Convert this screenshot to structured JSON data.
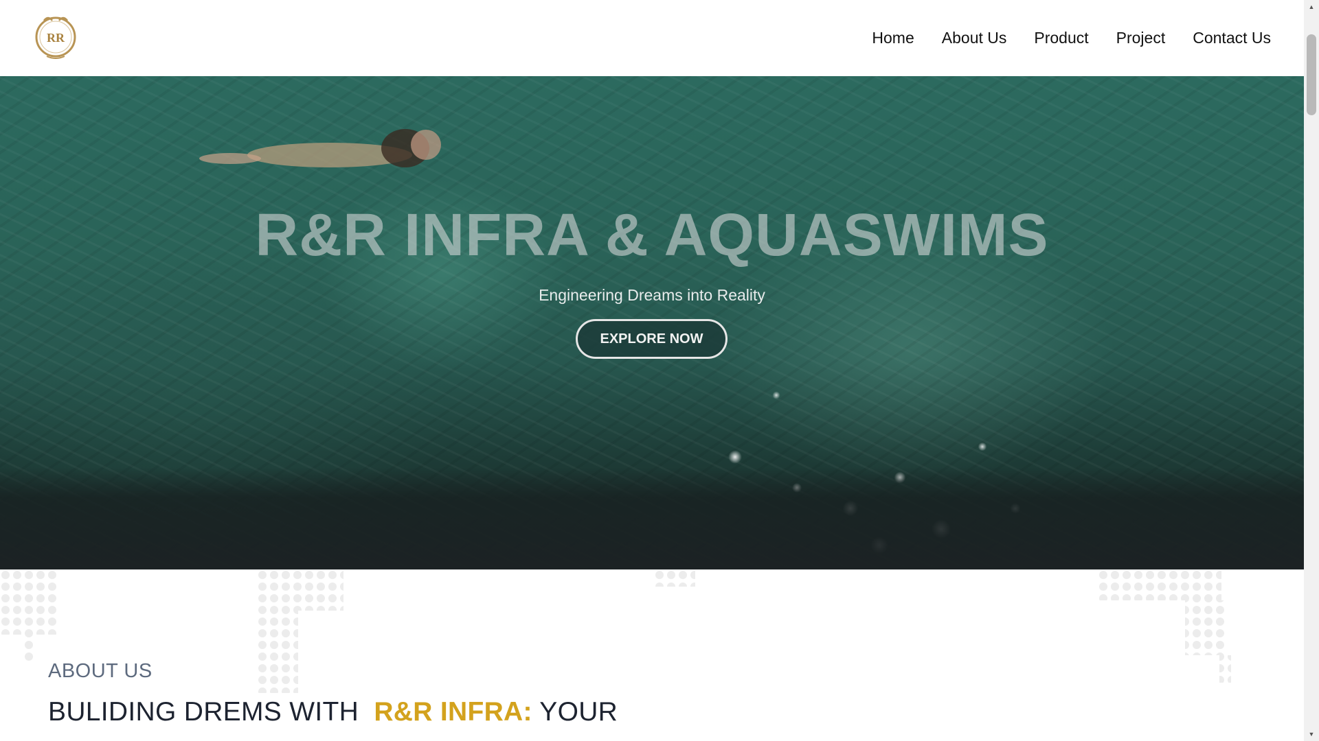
{
  "header": {
    "logo_text": "RR",
    "nav": [
      "Home",
      "About Us",
      "Product",
      "Project",
      "Contact Us"
    ]
  },
  "hero": {
    "title": "R&R INFRA & AQUASWIMS",
    "subtitle": "Engineering Dreams into Reality",
    "cta_label": "EXPLORE NOW"
  },
  "about": {
    "label": "ABOUT US",
    "heading_part1": "BULIDING DREMS WITH",
    "heading_highlight": "R&R INFRA:",
    "heading_part2": "YOUR"
  },
  "colors": {
    "accent_gold": "#d3a21d",
    "logo_gold": "#b89454",
    "hero_water": "#2a6358"
  },
  "icons": {
    "logo": "rr-logo-icon",
    "scroll_up": "chevron-up-icon",
    "scroll_down": "chevron-down-icon"
  }
}
